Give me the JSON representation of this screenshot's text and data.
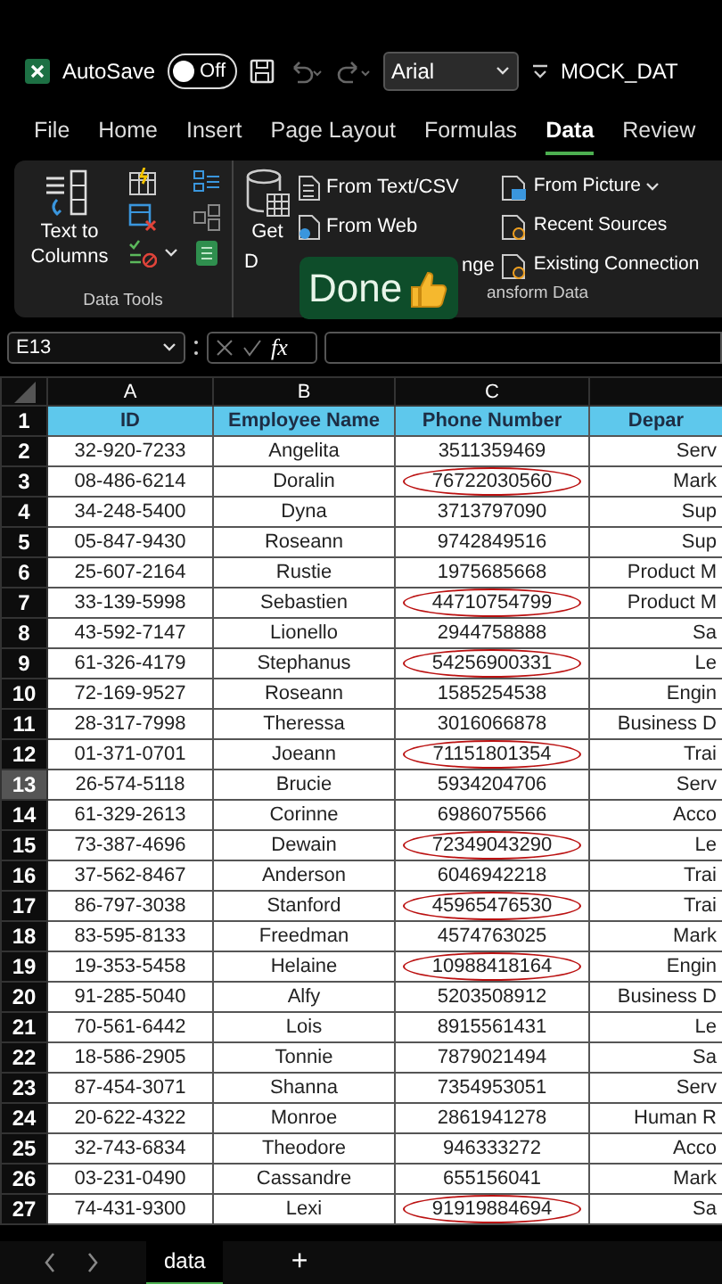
{
  "title_bar": {
    "autosave_label": "AutoSave",
    "autosave_on": false,
    "toggle_text": "Off",
    "font": "Arial",
    "file_name": "MOCK_DAT"
  },
  "tabs": [
    {
      "label": "File",
      "selected": false
    },
    {
      "label": "Home",
      "selected": false
    },
    {
      "label": "Insert",
      "selected": false
    },
    {
      "label": "Page Layout",
      "selected": false
    },
    {
      "label": "Formulas",
      "selected": false
    },
    {
      "label": "Data",
      "selected": true
    },
    {
      "label": "Review",
      "selected": false
    }
  ],
  "ribbon": {
    "text_to_columns": "Text to Columns",
    "data_tools_label": "Data Tools",
    "get_data": "Get",
    "get_data_cut": "D",
    "import_items": [
      {
        "label": "From Text/CSV"
      },
      {
        "label": "From Web"
      },
      {
        "label": "nge"
      }
    ],
    "source_items": [
      {
        "label": "From Picture",
        "dropdown": true
      },
      {
        "label": "Recent Sources",
        "dropdown": false
      },
      {
        "label": "Existing Connection",
        "dropdown": false
      }
    ],
    "transform_label": "ansform Data"
  },
  "sticker": {
    "text": "Done"
  },
  "formula_bar": {
    "name_box": "E13",
    "fx": "fx"
  },
  "columns": [
    "A",
    "B",
    "C"
  ],
  "header": {
    "n": "1",
    "id": "ID",
    "name": "Employee Name",
    "phone": "Phone Number",
    "dept": "Depar"
  },
  "rows": [
    {
      "n": "2",
      "id": "32-920-7233",
      "name": "Angelita",
      "phone": "3511359469",
      "dept": "Serv",
      "flagged": false,
      "selected": false
    },
    {
      "n": "3",
      "id": "08-486-6214",
      "name": "Doralin",
      "phone": "76722030560",
      "dept": "Mark",
      "flagged": true,
      "selected": false
    },
    {
      "n": "4",
      "id": "34-248-5400",
      "name": "Dyna",
      "phone": "3713797090",
      "dept": "Sup",
      "flagged": false,
      "selected": false
    },
    {
      "n": "5",
      "id": "05-847-9430",
      "name": "Roseann",
      "phone": "9742849516",
      "dept": "Sup",
      "flagged": false,
      "selected": false
    },
    {
      "n": "6",
      "id": "25-607-2164",
      "name": "Rustie",
      "phone": "1975685668",
      "dept": "Product M",
      "flagged": false,
      "selected": false
    },
    {
      "n": "7",
      "id": "33-139-5998",
      "name": "Sebastien",
      "phone": "44710754799",
      "dept": "Product M",
      "flagged": true,
      "selected": false
    },
    {
      "n": "8",
      "id": "43-592-7147",
      "name": "Lionello",
      "phone": "2944758888",
      "dept": "Sa",
      "flagged": false,
      "selected": false
    },
    {
      "n": "9",
      "id": "61-326-4179",
      "name": "Stephanus",
      "phone": "54256900331",
      "dept": "Le",
      "flagged": true,
      "selected": false
    },
    {
      "n": "10",
      "id": "72-169-9527",
      "name": "Roseann",
      "phone": "1585254538",
      "dept": "Engin",
      "flagged": false,
      "selected": false
    },
    {
      "n": "11",
      "id": "28-317-7998",
      "name": "Theressa",
      "phone": "3016066878",
      "dept": "Business D",
      "flagged": false,
      "selected": false
    },
    {
      "n": "12",
      "id": "01-371-0701",
      "name": "Joeann",
      "phone": "71151801354",
      "dept": "Trai",
      "flagged": true,
      "selected": false
    },
    {
      "n": "13",
      "id": "26-574-5118",
      "name": "Brucie",
      "phone": "5934204706",
      "dept": "Serv",
      "flagged": false,
      "selected": true
    },
    {
      "n": "14",
      "id": "61-329-2613",
      "name": "Corinne",
      "phone": "6986075566",
      "dept": "Acco",
      "flagged": false,
      "selected": false
    },
    {
      "n": "15",
      "id": "73-387-4696",
      "name": "Dewain",
      "phone": "72349043290",
      "dept": "Le",
      "flagged": true,
      "selected": false
    },
    {
      "n": "16",
      "id": "37-562-8467",
      "name": "Anderson",
      "phone": "6046942218",
      "dept": "Trai",
      "flagged": false,
      "selected": false
    },
    {
      "n": "17",
      "id": "86-797-3038",
      "name": "Stanford",
      "phone": "45965476530",
      "dept": "Trai",
      "flagged": true,
      "selected": false
    },
    {
      "n": "18",
      "id": "83-595-8133",
      "name": "Freedman",
      "phone": "4574763025",
      "dept": "Mark",
      "flagged": false,
      "selected": false
    },
    {
      "n": "19",
      "id": "19-353-5458",
      "name": "Helaine",
      "phone": "10988418164",
      "dept": "Engin",
      "flagged": true,
      "selected": false
    },
    {
      "n": "20",
      "id": "91-285-5040",
      "name": "Alfy",
      "phone": "5203508912",
      "dept": "Business D",
      "flagged": false,
      "selected": false
    },
    {
      "n": "21",
      "id": "70-561-6442",
      "name": "Lois",
      "phone": "8915561431",
      "dept": "Le",
      "flagged": false,
      "selected": false
    },
    {
      "n": "22",
      "id": "18-586-2905",
      "name": "Tonnie",
      "phone": "7879021494",
      "dept": "Sa",
      "flagged": false,
      "selected": false
    },
    {
      "n": "23",
      "id": "87-454-3071",
      "name": "Shanna",
      "phone": "7354953051",
      "dept": "Serv",
      "flagged": false,
      "selected": false
    },
    {
      "n": "24",
      "id": "20-622-4322",
      "name": "Monroe",
      "phone": "2861941278",
      "dept": "Human R",
      "flagged": false,
      "selected": false
    },
    {
      "n": "25",
      "id": "32-743-6834",
      "name": "Theodore",
      "phone": "946333272",
      "dept": "Acco",
      "flagged": false,
      "selected": false
    },
    {
      "n": "26",
      "id": "03-231-0490",
      "name": "Cassandre",
      "phone": "655156041",
      "dept": "Mark",
      "flagged": false,
      "selected": false
    },
    {
      "n": "27",
      "id": "74-431-9300",
      "name": "Lexi",
      "phone": "91919884694",
      "dept": "Sa",
      "flagged": true,
      "selected": false
    }
  ],
  "sheet_tabs": [
    {
      "label": "data",
      "selected": true
    }
  ],
  "add_sheet": "+"
}
